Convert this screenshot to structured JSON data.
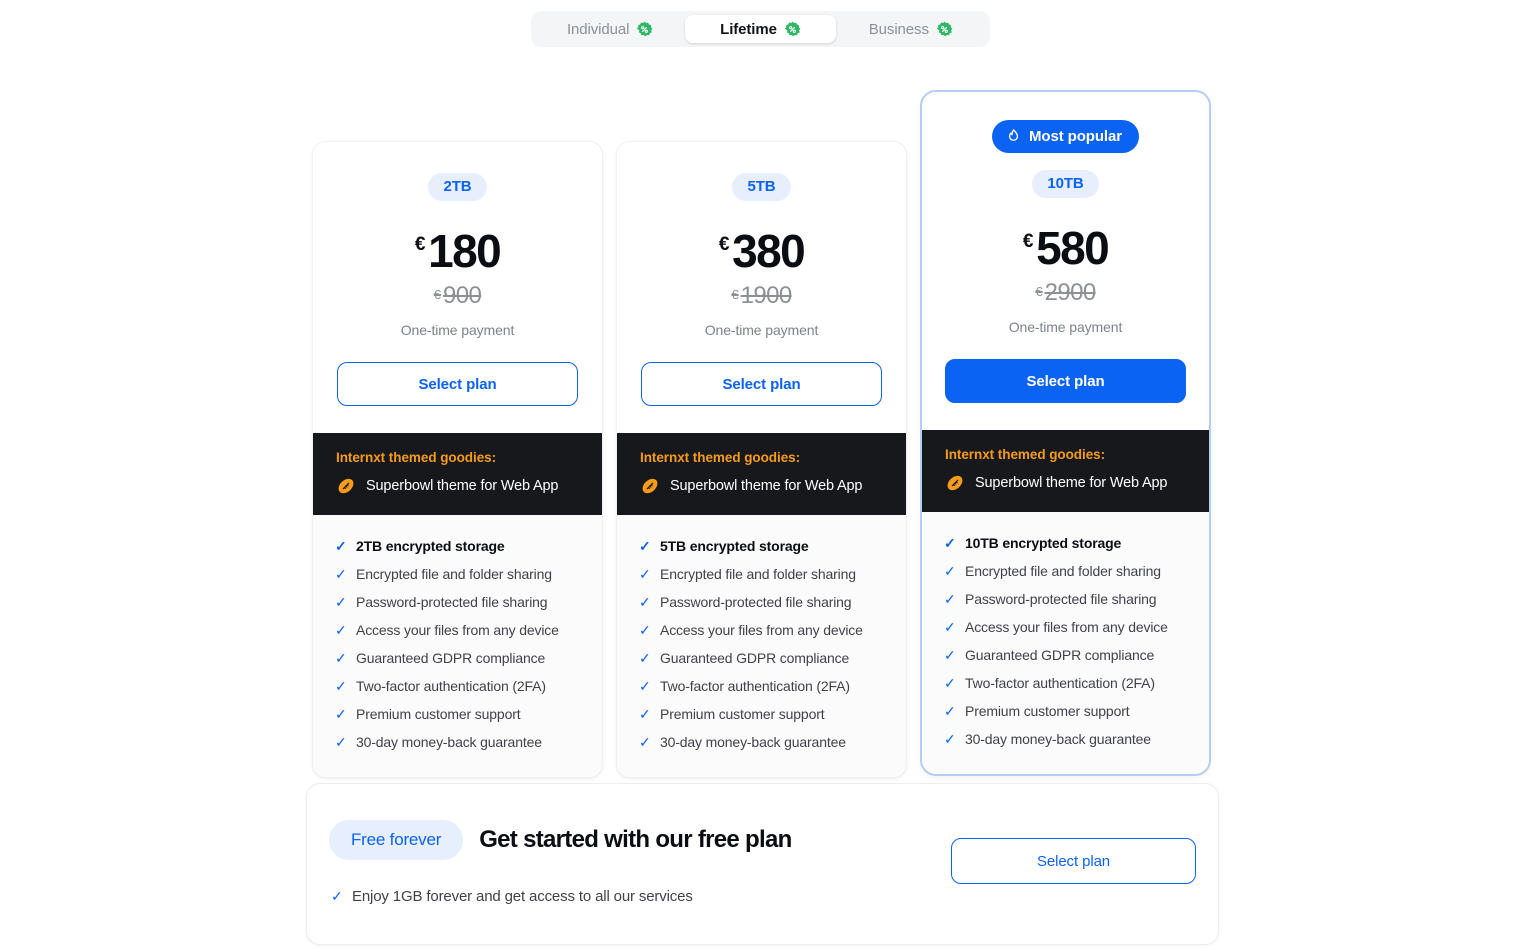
{
  "tabs": {
    "items": [
      {
        "label": "Individual",
        "active": false,
        "badge_icon": "percent-badge-icon"
      },
      {
        "label": "Lifetime",
        "active": true,
        "badge_icon": "percent-badge-icon"
      },
      {
        "label": "Business",
        "active": false,
        "badge_icon": "percent-badge-icon"
      }
    ]
  },
  "colors": {
    "accent_blue": "#0b63f3",
    "pill_blue_bg": "#e7eefd",
    "goodies_orange": "#f79c1a",
    "goodies_bg": "#17181c",
    "badge_green": "#2eb866",
    "highlight_border": "#b5cdf3"
  },
  "popular_badge": {
    "label": "Most popular",
    "icon": "flame-icon"
  },
  "plans": [
    {
      "size": "2TB",
      "currency": "€",
      "price": "180",
      "old_currency": "€",
      "old_price": "900",
      "billing_note": "One-time payment",
      "cta": "Select plan",
      "highlighted": false,
      "goodies_title": "Internxt themed goodies:",
      "goodies_item": "Superbowl theme for Web App",
      "goodies_icon": "football-icon",
      "features": [
        "2TB encrypted storage",
        "Encrypted file and folder sharing",
        "Password-protected file sharing",
        "Access your files from any device",
        "Guaranteed GDPR compliance",
        "Two-factor authentication (2FA)",
        "Premium customer support",
        "30-day money-back guarantee"
      ]
    },
    {
      "size": "5TB",
      "currency": "€",
      "price": "380",
      "old_currency": "€",
      "old_price": "1900",
      "billing_note": "One-time payment",
      "cta": "Select plan",
      "highlighted": false,
      "goodies_title": "Internxt themed goodies:",
      "goodies_item": "Superbowl theme for Web App",
      "goodies_icon": "football-icon",
      "features": [
        "5TB encrypted storage",
        "Encrypted file and folder sharing",
        "Password-protected file sharing",
        "Access your files from any device",
        "Guaranteed GDPR compliance",
        "Two-factor authentication (2FA)",
        "Premium customer support",
        "30-day money-back guarantee"
      ]
    },
    {
      "size": "10TB",
      "currency": "€",
      "price": "580",
      "old_currency": "€",
      "old_price": "2900",
      "billing_note": "One-time payment",
      "cta": "Select plan",
      "highlighted": true,
      "goodies_title": "Internxt themed goodies:",
      "goodies_item": "Superbowl theme for Web App",
      "goodies_icon": "football-icon",
      "features": [
        "10TB encrypted storage",
        "Encrypted file and folder sharing",
        "Password-protected file sharing",
        "Access your files from any device",
        "Guaranteed GDPR compliance",
        "Two-factor authentication (2FA)",
        "Premium customer support",
        "30-day money-back guarantee"
      ]
    }
  ],
  "free_plan": {
    "pill": "Free forever",
    "title": "Get started with our free plan",
    "feature": "Enjoy 1GB forever and get access to all our services",
    "cta": "Select plan"
  }
}
